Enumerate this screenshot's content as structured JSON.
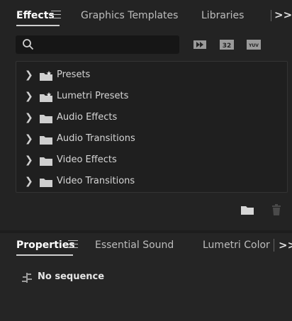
{
  "effects_panel": {
    "tabs": [
      {
        "label": "Effects",
        "active": true
      },
      {
        "label": "Graphics Templates",
        "active": false
      },
      {
        "label": "Libraries",
        "active": false
      }
    ],
    "overflow_label": ">>",
    "search": {
      "value": "",
      "placeholder": ""
    },
    "filter_buttons": [
      "accelerated-effects-icon",
      "32-bit-icon",
      "yuv-icon"
    ],
    "filter_labels": {
      "b32": "32",
      "yuv": "YUV"
    },
    "tree": [
      {
        "label": "Presets",
        "icon": "preset-folder-icon"
      },
      {
        "label": "Lumetri Presets",
        "icon": "preset-folder-icon"
      },
      {
        "label": "Audio Effects",
        "icon": "folder-icon"
      },
      {
        "label": "Audio Transitions",
        "icon": "folder-icon"
      },
      {
        "label": "Video Effects",
        "icon": "folder-icon"
      },
      {
        "label": "Video Transitions",
        "icon": "folder-icon"
      }
    ],
    "footer_buttons": [
      "new-bin-icon",
      "trash-icon"
    ]
  },
  "properties_panel": {
    "tabs": [
      {
        "label": "Properties",
        "active": true
      },
      {
        "label": "Essential Sound",
        "active": false
      },
      {
        "label": "Lumetri Color",
        "active": false
      }
    ],
    "overflow_label": ">>",
    "status": "No sequence"
  },
  "colors": {
    "panel_bg": "#232323",
    "tree_bg": "#1f1f1f",
    "search_bg": "#161616",
    "text": "#d6d6d6",
    "active_text": "#ffffff"
  }
}
